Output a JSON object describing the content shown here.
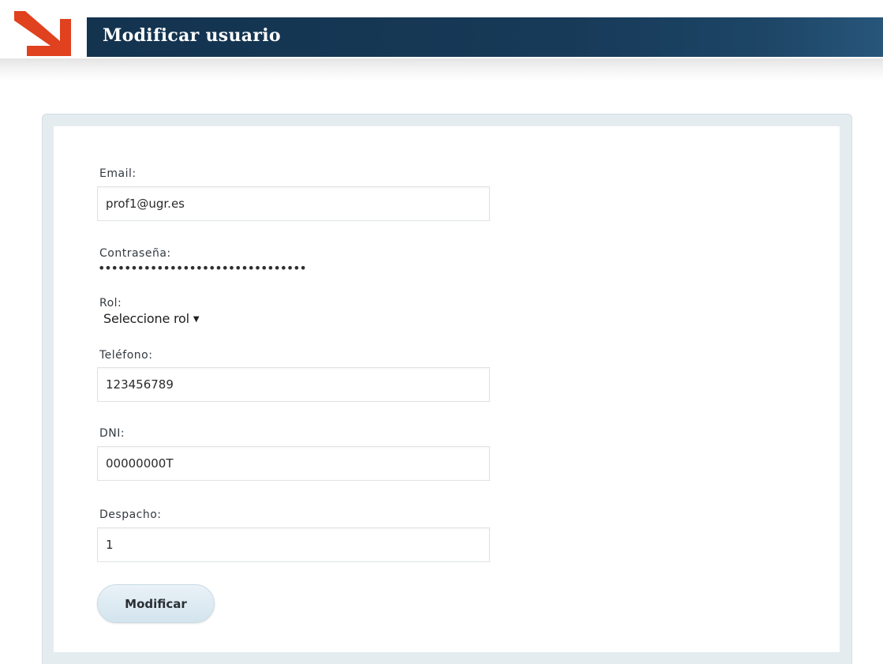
{
  "header": {
    "title": "Modificar usuario",
    "accent_color": "#e0411f",
    "bar_color": "#13334f"
  },
  "form": {
    "email": {
      "label": "Email:",
      "value": "prof1@ugr.es"
    },
    "password": {
      "label": "Contraseña:",
      "masked_value": "••••••••••••••••••••••••••••••••"
    },
    "rol": {
      "label": "Rol:",
      "selected": "Seleccione rol"
    },
    "telefono": {
      "label": "Teléfono:",
      "value": "123456789"
    },
    "dni": {
      "label": "DNI:",
      "value": "00000000T"
    },
    "despacho": {
      "label": "Despacho:",
      "value": "1"
    },
    "submit_label": "Modificar"
  }
}
